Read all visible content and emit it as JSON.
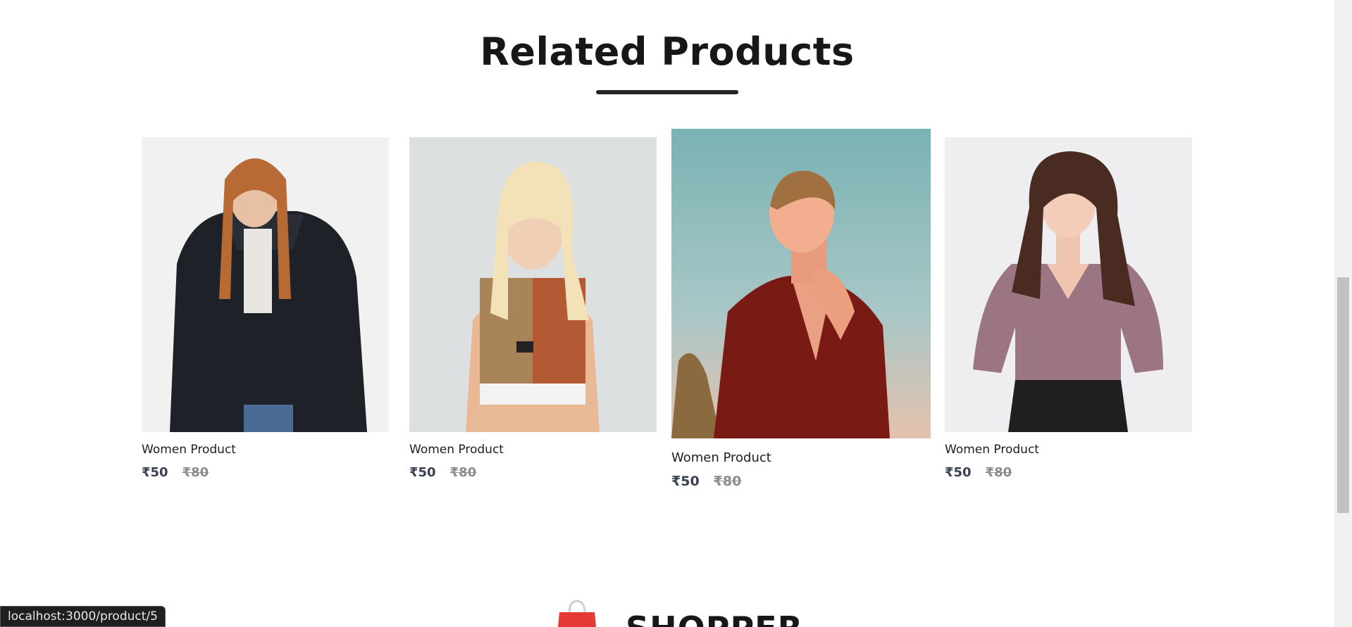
{
  "section": {
    "title": "Related Products"
  },
  "products": [
    {
      "name": "Women Product",
      "new_price": "₹50",
      "old_price": "₹80"
    },
    {
      "name": "Women Product",
      "new_price": "₹50",
      "old_price": "₹80"
    },
    {
      "name": "Women Product",
      "new_price": "₹50",
      "old_price": "₹80"
    },
    {
      "name": "Women Product",
      "new_price": "₹50",
      "old_price": "₹80"
    }
  ],
  "footer": {
    "brand": "SHOPPER"
  },
  "status_bar": {
    "url": "localhost:3000/product/5"
  },
  "colors": {
    "title": "#171717",
    "underline": "#252525",
    "new_price": "#374151",
    "old_price": "#8c8c8c",
    "bag_icon": "#e53935"
  }
}
